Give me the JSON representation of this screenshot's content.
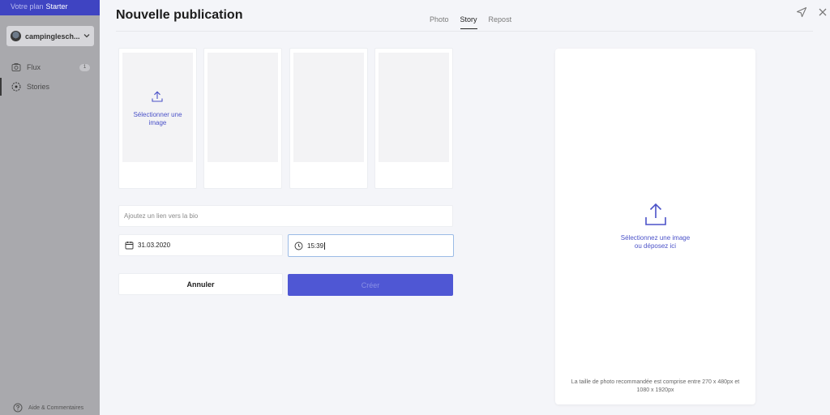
{
  "sidebar": {
    "plan_prefix": "Votre plan",
    "plan_name": "Starter",
    "account_name": "campinglesch...",
    "nav": {
      "flux_label": "Flux",
      "flux_badge": "1",
      "stories_label": "Stories"
    },
    "help_label": "Aide & Commentaires"
  },
  "modal": {
    "title": "Nouvelle publication",
    "tabs": [
      "Photo",
      "Story",
      "Repost"
    ],
    "active_tab": "Story",
    "story_slots": {
      "select_label_line1": "Sélectionner une",
      "select_label_line2": "image"
    },
    "link_placeholder": "Ajoutez un lien vers la bio",
    "date_value": "31.03.2020",
    "time_value": "15:39",
    "cancel_label": "Annuler",
    "create_label": "Créer",
    "preview": {
      "line1": "Sélectionnez une image",
      "line2": "ou déposez ici",
      "note_line1": "La taille de photo recommandée est comprise entre 270 x 480px et",
      "note_line2": "1080 x 1920px"
    }
  },
  "colors": {
    "accent": "#4f57d4",
    "link_text": "#4b52c8",
    "plan_bar": "#3f44c2"
  },
  "icons": [
    "send-icon",
    "close-icon",
    "upload-icon",
    "calendar-icon",
    "clock-icon",
    "camera-icon",
    "stories-icon",
    "help-icon",
    "chevron-down-icon"
  ]
}
